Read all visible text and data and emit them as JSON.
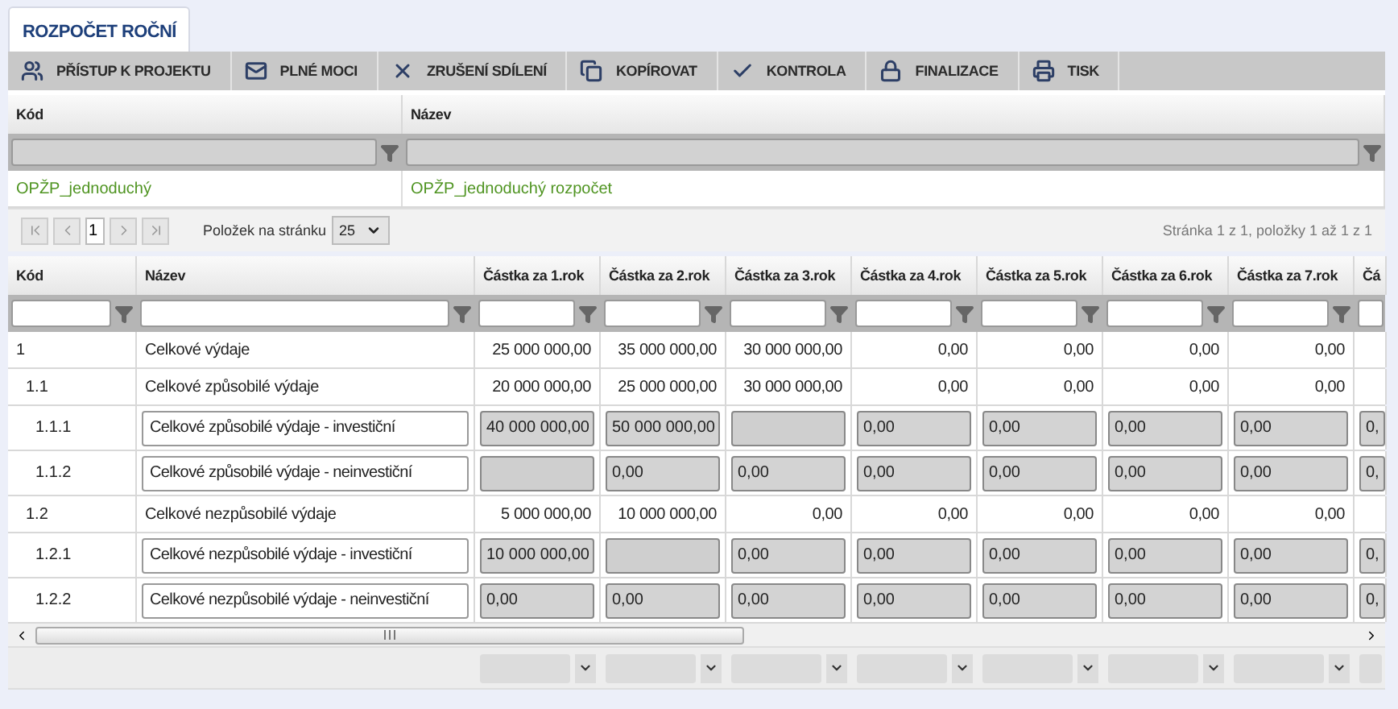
{
  "tabs": [
    {
      "label": "ROZPOČET ROČNÍ",
      "selected": true
    }
  ],
  "toolbar": [
    {
      "label": "PŘÍSTUP K PROJEKTU"
    },
    {
      "label": "PLNÉ MOCI"
    },
    {
      "label": "ZRUŠENÍ SDÍLENÍ"
    },
    {
      "label": "KOPÍROVAT"
    },
    {
      "label": "KONTROLA"
    },
    {
      "label": "FINALIZACE"
    },
    {
      "label": "TISK"
    }
  ],
  "top_grid": {
    "columns": [
      "Kód",
      "Název"
    ],
    "rows": [
      [
        "OPŽP_jednoduchý",
        "OPŽP_jednoduchý rozpočet"
      ]
    ],
    "pager": {
      "page": "1",
      "page_size_label": "Položek na stránku",
      "page_size": "25",
      "summary": "Stránka 1 z 1, položky 1 až 1 z 1"
    }
  },
  "budget_grid": {
    "columns": [
      "Kód",
      "Název",
      "Částka za 1.rok",
      "Částka za 2.rok",
      "Částka za 3.rok",
      "Částka za 4.rok",
      "Částka za 5.rok",
      "Částka za 6.rok",
      "Částka za 7.rok",
      "Čá"
    ],
    "rows": [
      {
        "code": "1",
        "name": "Celkové výdaje",
        "kind": "sum",
        "amounts": [
          {
            "value": "25 000 000,00"
          },
          {
            "value": "35 000 000,00"
          },
          {
            "value": "30 000 000,00"
          },
          {
            "value": "0,00"
          },
          {
            "value": "0,00"
          },
          {
            "value": "0,00"
          },
          {
            "value": "0,00"
          }
        ],
        "children": [
          {
            "code": "1.1",
            "name": "Celkové způsobilé výdaje",
            "kind": "sum",
            "amounts": [
              {
                "value": "20 000 000,00"
              },
              {
                "value": "25 000 000,00"
              },
              {
                "value": "30 000 000,00"
              },
              {
                "value": "0,00"
              },
              {
                "value": "0,00"
              },
              {
                "value": "0,00"
              },
              {
                "value": "0,00"
              }
            ],
            "children": [
              {
                "code": "1.1.1",
                "name": "Celkové způsobilé výdaje - investiční",
                "kind": "input",
                "amounts": [
                  {
                    "value": "40 000 000,00"
                  },
                  {
                    "value": "50 000 000,00"
                  },
                  {
                    "blank": true
                  },
                  {
                    "value": "0,00"
                  },
                  {
                    "value": "0,00"
                  },
                  {
                    "value": "0,00"
                  },
                  {
                    "value": "0,00"
                  },
                  {
                    "value": "0,"
                  }
                ]
              },
              {
                "code": "1.1.2",
                "name": "Celkové způsobilé výdaje - neinvestiční",
                "kind": "input",
                "amounts": [
                  {
                    "blank": true
                  },
                  {
                    "value": "0,00"
                  },
                  {
                    "value": "0,00"
                  },
                  {
                    "value": "0,00"
                  },
                  {
                    "value": "0,00"
                  },
                  {
                    "value": "0,00"
                  },
                  {
                    "value": "0,00"
                  },
                  {
                    "value": "0,"
                  }
                ]
              }
            ]
          },
          {
            "code": "1.2",
            "name": "Celkové nezpůsobilé výdaje",
            "kind": "sum",
            "amounts": [
              {
                "value": "5 000 000,00"
              },
              {
                "value": "10 000 000,00"
              },
              {
                "value": "0,00"
              },
              {
                "value": "0,00"
              },
              {
                "value": "0,00"
              },
              {
                "value": "0,00"
              },
              {
                "value": "0,00"
              }
            ],
            "children": [
              {
                "code": "1.2.1",
                "name": "Celkové nezpůsobilé výdaje - investiční",
                "kind": "input",
                "amounts": [
                  {
                    "value": "10 000 000,00"
                  },
                  {
                    "blank": true
                  },
                  {
                    "value": "0,00"
                  },
                  {
                    "value": "0,00"
                  },
                  {
                    "value": "0,00"
                  },
                  {
                    "value": "0,00"
                  },
                  {
                    "value": "0,00"
                  },
                  {
                    "value": "0,"
                  }
                ]
              },
              {
                "code": "1.2.2",
                "name": "Celkové nezpůsobilé výdaje - neinvestiční",
                "kind": "input",
                "amounts": [
                  {
                    "value": "0,00"
                  },
                  {
                    "value": "0,00"
                  },
                  {
                    "value": "0,00"
                  },
                  {
                    "value": "0,00"
                  },
                  {
                    "value": "0,00"
                  },
                  {
                    "value": "0,00"
                  },
                  {
                    "value": "0,00"
                  },
                  {
                    "value": "0,"
                  }
                ]
              }
            ]
          }
        ]
      }
    ]
  }
}
